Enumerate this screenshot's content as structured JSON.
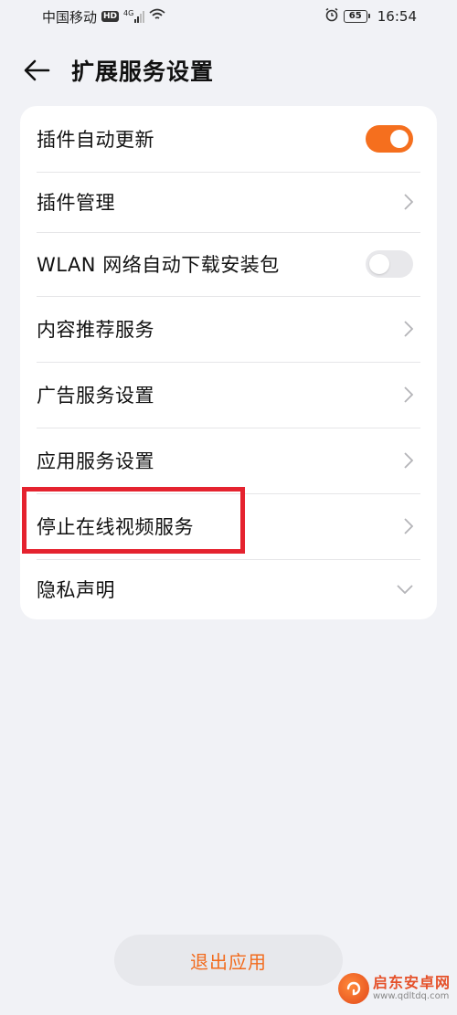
{
  "status_bar": {
    "carrier": "中国移动",
    "hd": "HD",
    "network": "4G",
    "battery": "65",
    "time": "16:54"
  },
  "header": {
    "title": "扩展服务设置"
  },
  "settings": {
    "plugin_auto_update": {
      "label": "插件自动更新",
      "enabled": true
    },
    "plugin_manage": {
      "label": "插件管理"
    },
    "wlan_auto_download": {
      "label": "WLAN 网络自动下载安装包",
      "enabled": false
    },
    "content_recommend": {
      "label": "内容推荐服务"
    },
    "ad_service": {
      "label": "广告服务设置"
    },
    "app_service": {
      "label": "应用服务设置"
    },
    "stop_online_video": {
      "label": "停止在线视频服务"
    },
    "privacy": {
      "label": "隐私声明"
    }
  },
  "footer": {
    "exit_label": "退出应用"
  },
  "watermark": {
    "name": "启东安卓网",
    "url": "www.qdltdq.com"
  },
  "colors": {
    "accent": "#f56f1e",
    "highlight": "#e5232f",
    "background": "#f1f2f6"
  }
}
